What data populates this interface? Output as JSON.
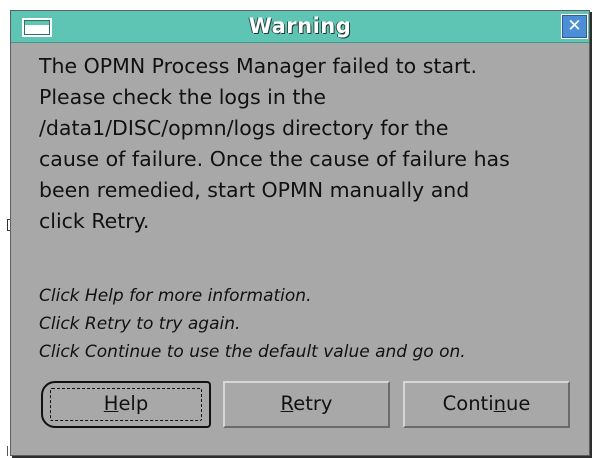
{
  "window": {
    "title": "Warning",
    "close_glyph": "✕",
    "system_menu_icon": "window-menu-icon",
    "close_icon": "close-icon"
  },
  "message": {
    "lines": [
      "The OPMN Process Manager failed to start.",
      "Please check the logs in the",
      "/data1/DISC/opmn/logs directory for the",
      "cause of failure. Once the cause of failure has",
      "been remedied, start OPMN manually and",
      "click Retry."
    ]
  },
  "hints": [
    "Click Help for more information.",
    "Click Retry to try again.",
    "Click Continue to use the default value and go on."
  ],
  "buttons": {
    "help": {
      "mnemonic": "H",
      "rest": "elp",
      "focused": true
    },
    "retry": {
      "mnemonic": "R",
      "rest": "etry"
    },
    "continue": {
      "before": "Conti",
      "mnemonic": "n",
      "rest": "ue"
    }
  },
  "colors": {
    "titlebar": "#5ec5b4",
    "dialog_bg": "#a8a8a8",
    "close_button": "#4d8fd6"
  }
}
